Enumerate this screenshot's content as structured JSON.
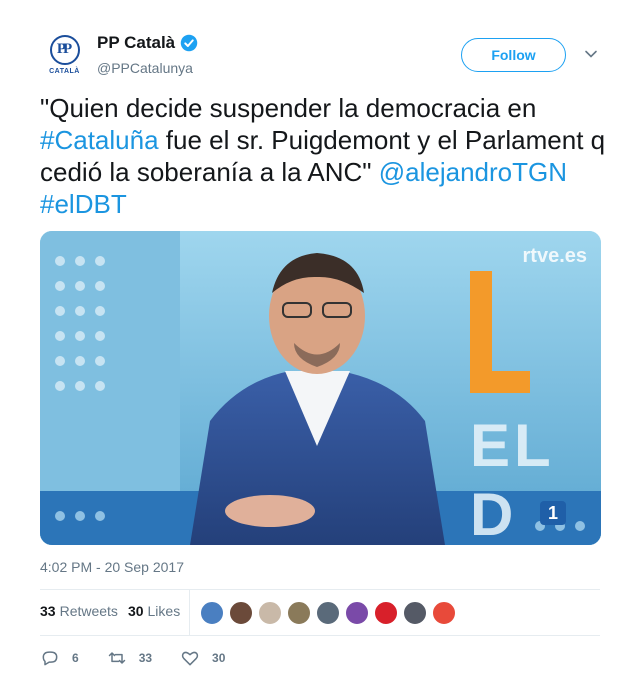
{
  "account": {
    "display_name": "PP Català",
    "handle": "@PPCatalunya",
    "verified": true,
    "avatar_logo_text": "PP",
    "avatar_caption": "CATALÀ"
  },
  "follow_label": "Follow",
  "tweet": {
    "parts": [
      {
        "text": "\"Quien decide suspender la democracia en ",
        "link": false
      },
      {
        "text": "#Cataluña",
        "link": true
      },
      {
        "text": " fue el sr. Puigdemont y el Parlament q cedió la soberanía a la ANC\" ",
        "link": false
      },
      {
        "text": "@alejandroTGN",
        "link": true
      },
      {
        "text": " ",
        "link": false
      },
      {
        "text": "#elDBT",
        "link": true
      }
    ]
  },
  "media": {
    "watermark": "rtve.es",
    "channel_badge": "1",
    "backdrop_letters": "EL D"
  },
  "timestamp": "4:02 PM - 20 Sep 2017",
  "stats": {
    "retweets_count": "33",
    "retweets_label": "Retweets",
    "likes_count": "30",
    "likes_label": "Likes"
  },
  "likers": [
    "#4a7fc1",
    "#6b4a3a",
    "#c9b9a8",
    "#8a7a5a",
    "#5a6a7a",
    "#7a4aa8",
    "#d8202a",
    "#555a66",
    "#e84a3a"
  ],
  "actions": {
    "reply_count": "6",
    "retweet_count": "33",
    "like_count": "30"
  },
  "colors": {
    "accent": "#1da1f2",
    "link": "#1b95e0",
    "muted": "#657786"
  }
}
